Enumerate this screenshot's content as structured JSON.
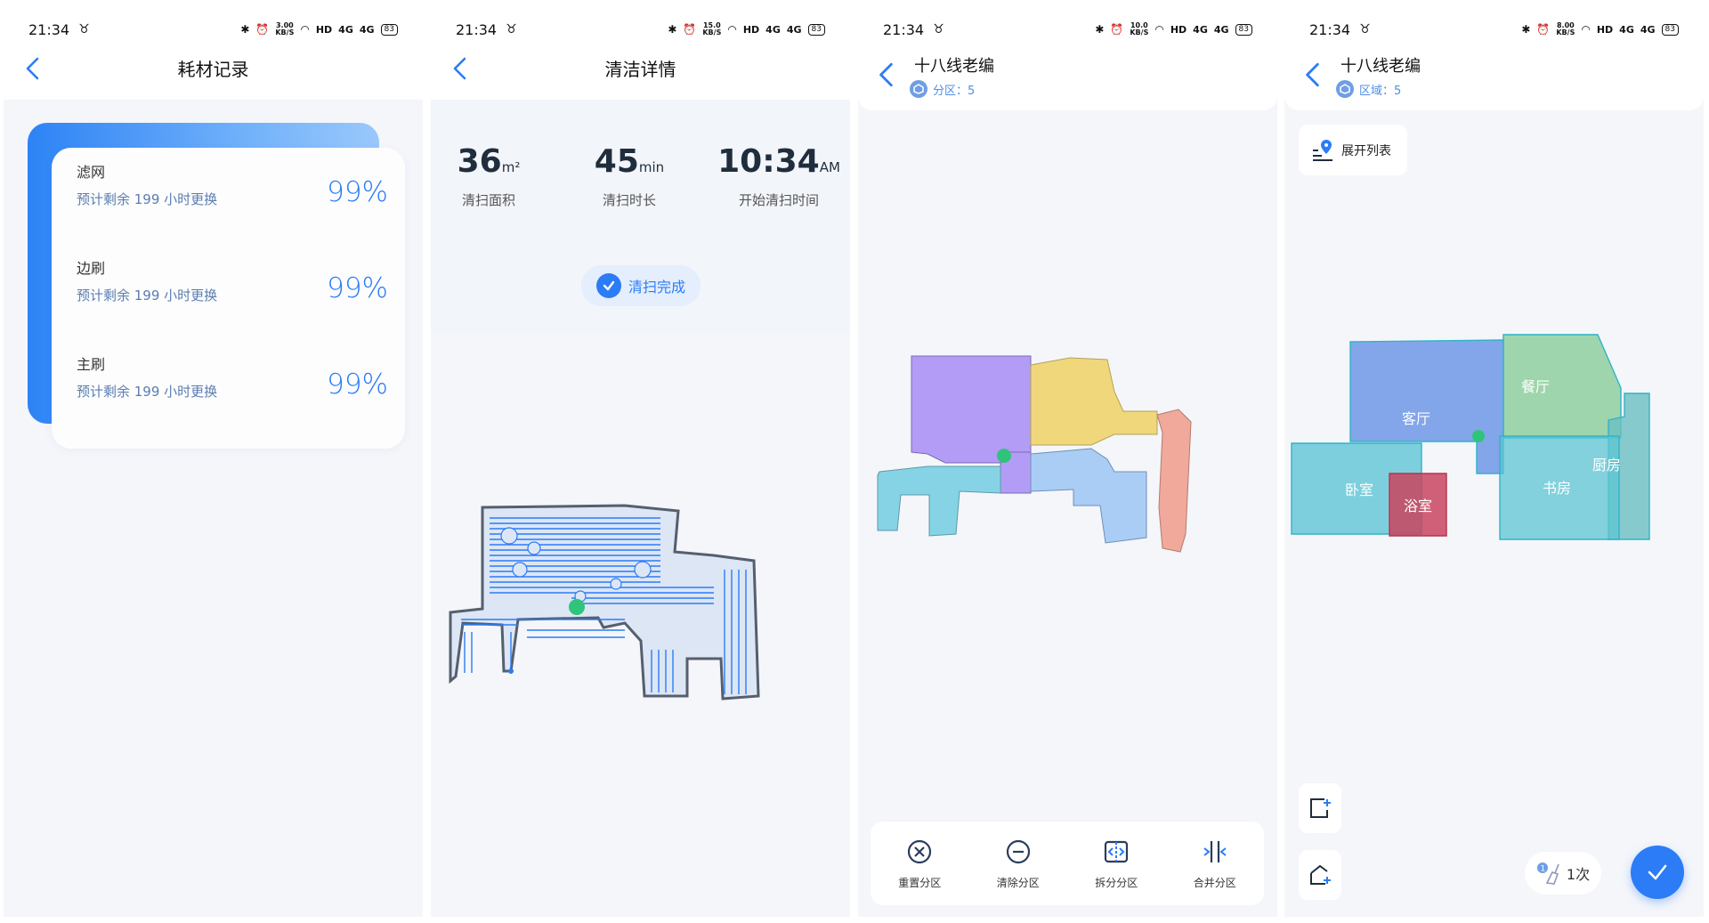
{
  "status_bar": {
    "time": "21:34",
    "hd": "HD",
    "signal1": "4G",
    "signal2": "4G",
    "battery": "83",
    "speeds": [
      "3.00",
      "15.0",
      "10.0",
      "8.00"
    ],
    "speed_unit": "KB/S"
  },
  "screen1": {
    "title": "耗材记录",
    "items": [
      {
        "name": "滤网",
        "remain": "预计剩余 199 小时更换",
        "percent": "99%"
      },
      {
        "name": "边刷",
        "remain": "预计剩余 199 小时更换",
        "percent": "99%"
      },
      {
        "name": "主刷",
        "remain": "预计剩余 199 小时更换",
        "percent": "99%"
      }
    ]
  },
  "screen2": {
    "title": "清洁详情",
    "area": {
      "value": "36",
      "unit": "m²",
      "label": "清扫面积"
    },
    "duration": {
      "value": "45",
      "unit": "min",
      "label": "清扫时长"
    },
    "start": {
      "value": "10:34",
      "unit": "AM",
      "label": "开始清扫时间"
    },
    "status": "清扫完成"
  },
  "screen3": {
    "title": "十八线老编",
    "subtitle": "分区：5",
    "tools": [
      {
        "label": "重置分区",
        "icon": "reset-x-icon"
      },
      {
        "label": "清除分区",
        "icon": "minus-circle-icon"
      },
      {
        "label": "拆分分区",
        "icon": "split-icon"
      },
      {
        "label": "合并分区",
        "icon": "merge-icon"
      }
    ]
  },
  "screen4": {
    "title": "十八线老编",
    "subtitle": "区域：5",
    "expand_label": "展开列表",
    "rooms": {
      "living": "客厅",
      "dining": "餐厅",
      "kitchen": "厨房",
      "bedroom": "卧室",
      "bathroom": "浴室",
      "study": "书房"
    },
    "count_badge": "1",
    "count_label": "1次"
  },
  "colors": {
    "accent": "#2b7cf6",
    "zone_purple": "#b39cf5",
    "zone_yellow": "#f0d77c",
    "zone_salmon": "#f0a99a",
    "zone_cyan": "#86d3e6",
    "zone_lightblue": "#a9cdf5"
  }
}
